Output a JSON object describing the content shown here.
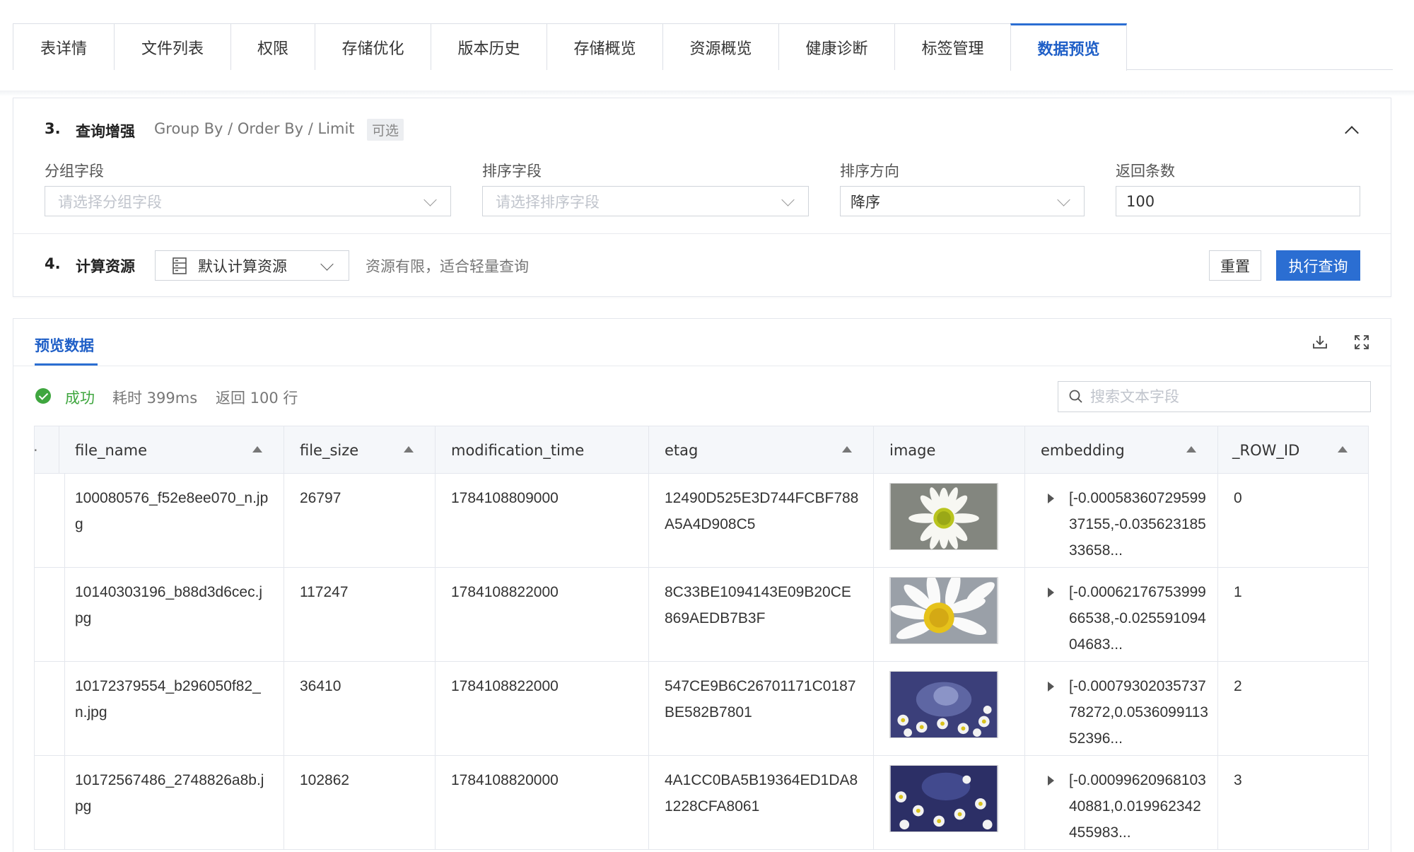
{
  "tabs": [
    {
      "label": "表详情"
    },
    {
      "label": "文件列表"
    },
    {
      "label": "权限"
    },
    {
      "label": "存储优化"
    },
    {
      "label": "版本历史"
    },
    {
      "label": "存储概览"
    },
    {
      "label": "资源概览"
    },
    {
      "label": "健康诊断"
    },
    {
      "label": "标签管理"
    },
    {
      "label": "数据预览",
      "active": true
    }
  ],
  "query_enhance": {
    "num": "3.",
    "title": "查询增强",
    "subtitle": "Group By / Order By / Limit",
    "optional_tag": "可选",
    "group_field": {
      "label": "分组字段",
      "placeholder": "请选择分组字段"
    },
    "sort_field": {
      "label": "排序字段",
      "placeholder": "请选择排序字段"
    },
    "sort_direction": {
      "label": "排序方向",
      "value": "降序"
    },
    "limit": {
      "label": "返回条数",
      "value": "100"
    }
  },
  "compute": {
    "num": "4.",
    "title": "计算资源",
    "resource": "默认计算资源",
    "hint": "资源有限，适合轻量查询",
    "reset_label": "重置",
    "run_label": "执行查询"
  },
  "preview": {
    "tab_label": "预览数据",
    "status": "成功",
    "elapsed": "耗时 399ms",
    "rows_returned": "返回 100 行",
    "search_placeholder": "搜索文本字段"
  },
  "table": {
    "columns": [
      "file_name",
      "file_size",
      "modification_time",
      "etag",
      "image",
      "embedding",
      "_ROW_ID"
    ],
    "rows": [
      {
        "file_name": "100080576_f52e8ee070_n.jpg",
        "file_size": "26797",
        "modification_time": "1784108809000",
        "etag": "12490D525E3D744FCBF788A5A4D908C5",
        "embedding": "[-0.0005836072959937155,-0.03562318533658...",
        "row_id": "0"
      },
      {
        "file_name": "10140303196_b88d3d6cec.jpg",
        "file_size": "117247",
        "modification_time": "1784108822000",
        "etag": "8C33BE1094143E09B20CE869AEDB7B3F",
        "embedding": "[-0.0006217675399966538,-0.02559109404683...",
        "row_id": "1"
      },
      {
        "file_name": "10172379554_b296050f82_n.jpg",
        "file_size": "36410",
        "modification_time": "1784108822000",
        "etag": "547CE9B6C26701171C0187BE582B7801",
        "embedding": "[-0.0007930203573778272,0.053609911352396...",
        "row_id": "2"
      },
      {
        "file_name": "10172567486_2748826a8b.jpg",
        "file_size": "102862",
        "modification_time": "1784108820000",
        "etag": "4A1CC0BA5B19364ED1DA81228CFA8061",
        "embedding": "[-0.0009962096810340881,0.019962342455983...",
        "row_id": "3"
      }
    ]
  },
  "colors": {
    "primary": "#2b6ed2",
    "success": "#3fa63f"
  }
}
